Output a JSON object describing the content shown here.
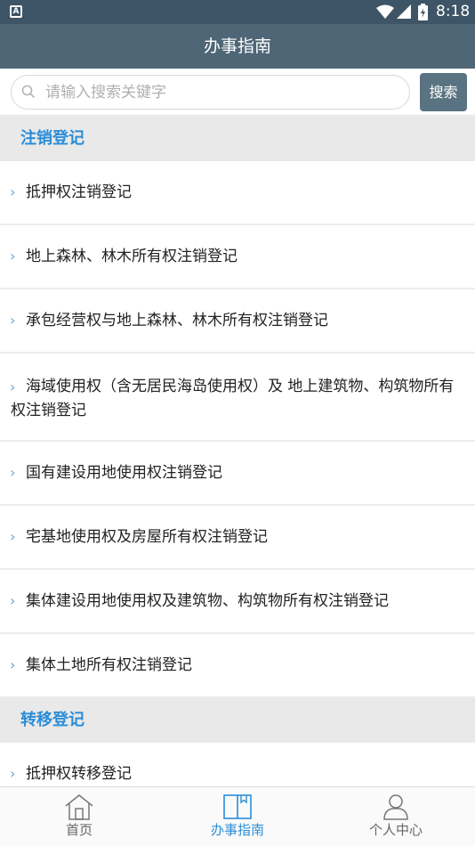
{
  "status_bar": {
    "app_badge": "A",
    "time": "8:18"
  },
  "header": {
    "title": "办事指南"
  },
  "search": {
    "placeholder": "请输入搜索关键字",
    "value": "",
    "button_label": "搜索"
  },
  "sections": [
    {
      "title": "注销登记",
      "items": [
        "抵押权注销登记",
        "地上森林、林木所有权注销登记",
        "承包经营权与地上森林、林木所有权注销登记",
        "海域使用权（含无居民海岛使用权）及 地上建筑物、构筑物所有权注销登记",
        "国有建设用地使用权注销登记",
        "宅基地使用权及房屋所有权注销登记",
        "集体建设用地使用权及建筑物、构筑物所有权注销登记",
        "集体土地所有权注销登记"
      ]
    },
    {
      "title": "转移登记",
      "items": [
        "抵押权转移登记"
      ]
    }
  ],
  "tabs": [
    {
      "label": "首页",
      "icon": "home-icon",
      "active": false
    },
    {
      "label": "办事指南",
      "icon": "book-icon",
      "active": true
    },
    {
      "label": "个人中心",
      "icon": "user-icon",
      "active": false
    }
  ],
  "colors": {
    "header": "#4f6677",
    "accent": "#2a8dd9",
    "search_button": "#5a7382"
  }
}
